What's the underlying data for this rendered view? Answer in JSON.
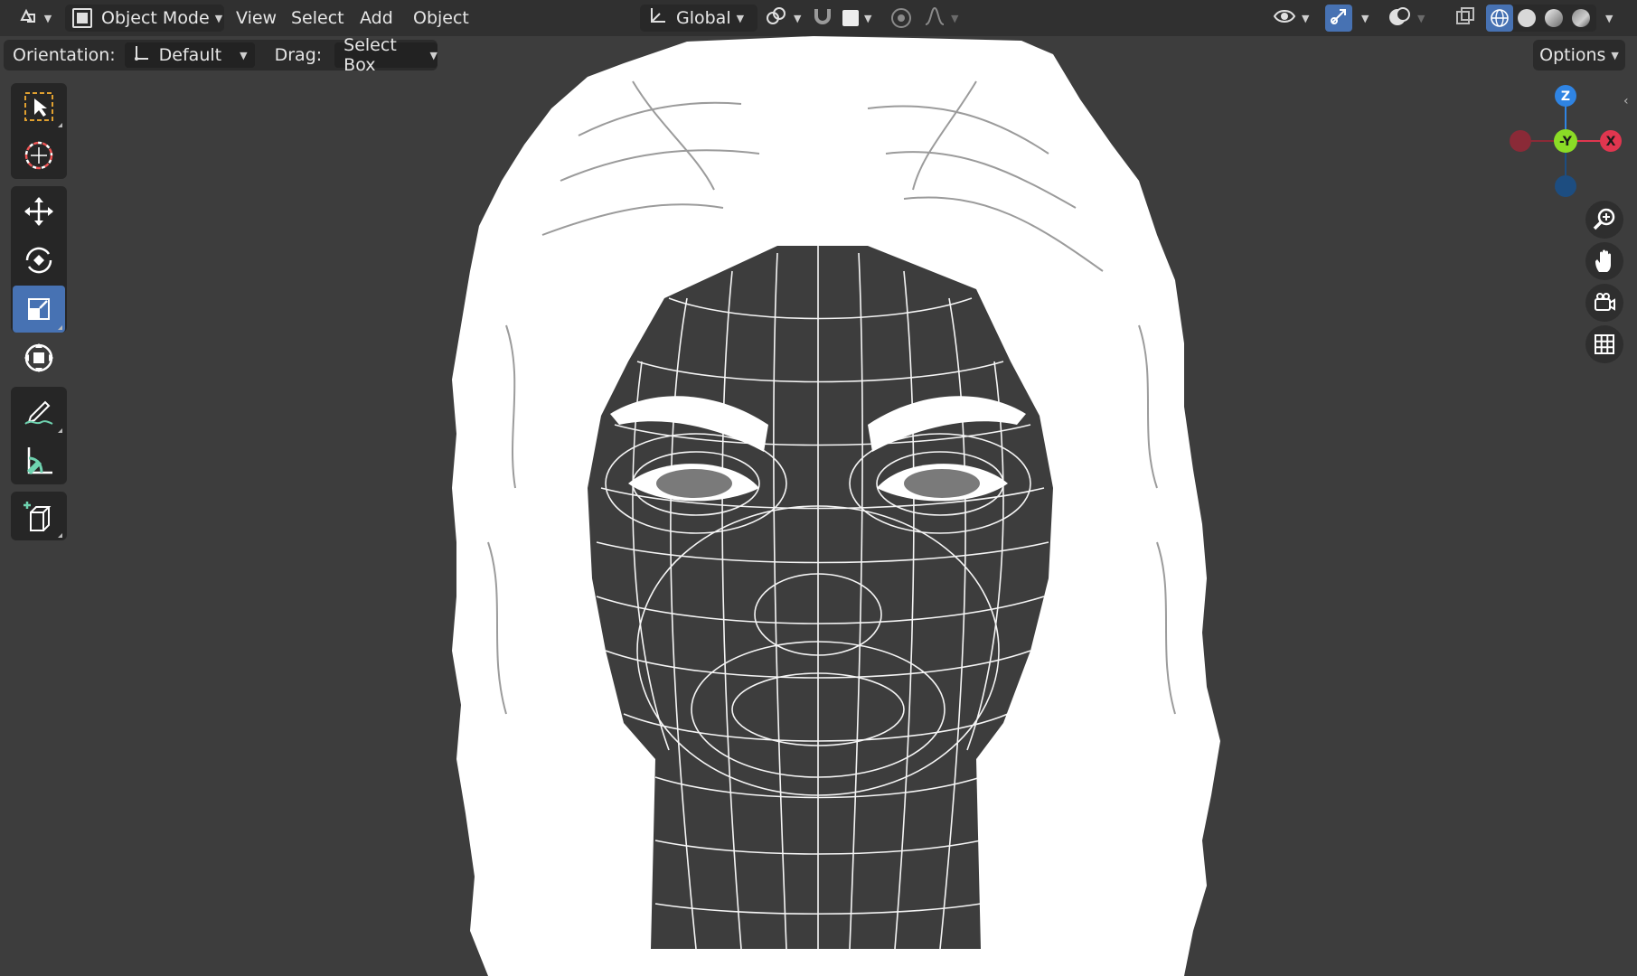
{
  "header": {
    "editor_type_icon": "editor-type-icon",
    "mode_label": "Object Mode",
    "menus": [
      "View",
      "Select",
      "Add",
      "Object"
    ],
    "transform_orientation_label": "Global"
  },
  "tool_settings": {
    "orientation_label": "Orientation:",
    "orientation_value": "Default",
    "drag_label": "Drag:",
    "drag_value": "Select Box",
    "options_label": "Options"
  },
  "toolbar": {
    "tools": [
      {
        "name": "select-box-tool",
        "icon": "select-box-icon"
      },
      {
        "name": "cursor-tool",
        "icon": "cursor-icon"
      },
      {
        "name": "move-tool",
        "icon": "move-icon"
      },
      {
        "name": "rotate-tool",
        "icon": "rotate-icon"
      },
      {
        "name": "scale-tool",
        "icon": "scale-icon",
        "active": true
      },
      {
        "name": "transform-tool",
        "icon": "transform-icon"
      },
      {
        "name": "annotate-tool",
        "icon": "annotate-icon"
      },
      {
        "name": "measure-tool",
        "icon": "measure-icon"
      },
      {
        "name": "add-cube-tool",
        "icon": "add-cube-icon"
      }
    ]
  },
  "gizmo": {
    "axis_z": "Z",
    "axis_y": "-Y",
    "axis_x": "X",
    "colors": {
      "x": "#e0364f",
      "y": "#8bdc26",
      "z": "#2f84e3",
      "neg_x": "#8a2a37",
      "neg_z": "#1d4d80"
    }
  },
  "colors": {
    "accent": "#4772b3",
    "header_bg": "#303030",
    "viewport_bg": "#3d3d3d",
    "wire": "#ffffff"
  }
}
